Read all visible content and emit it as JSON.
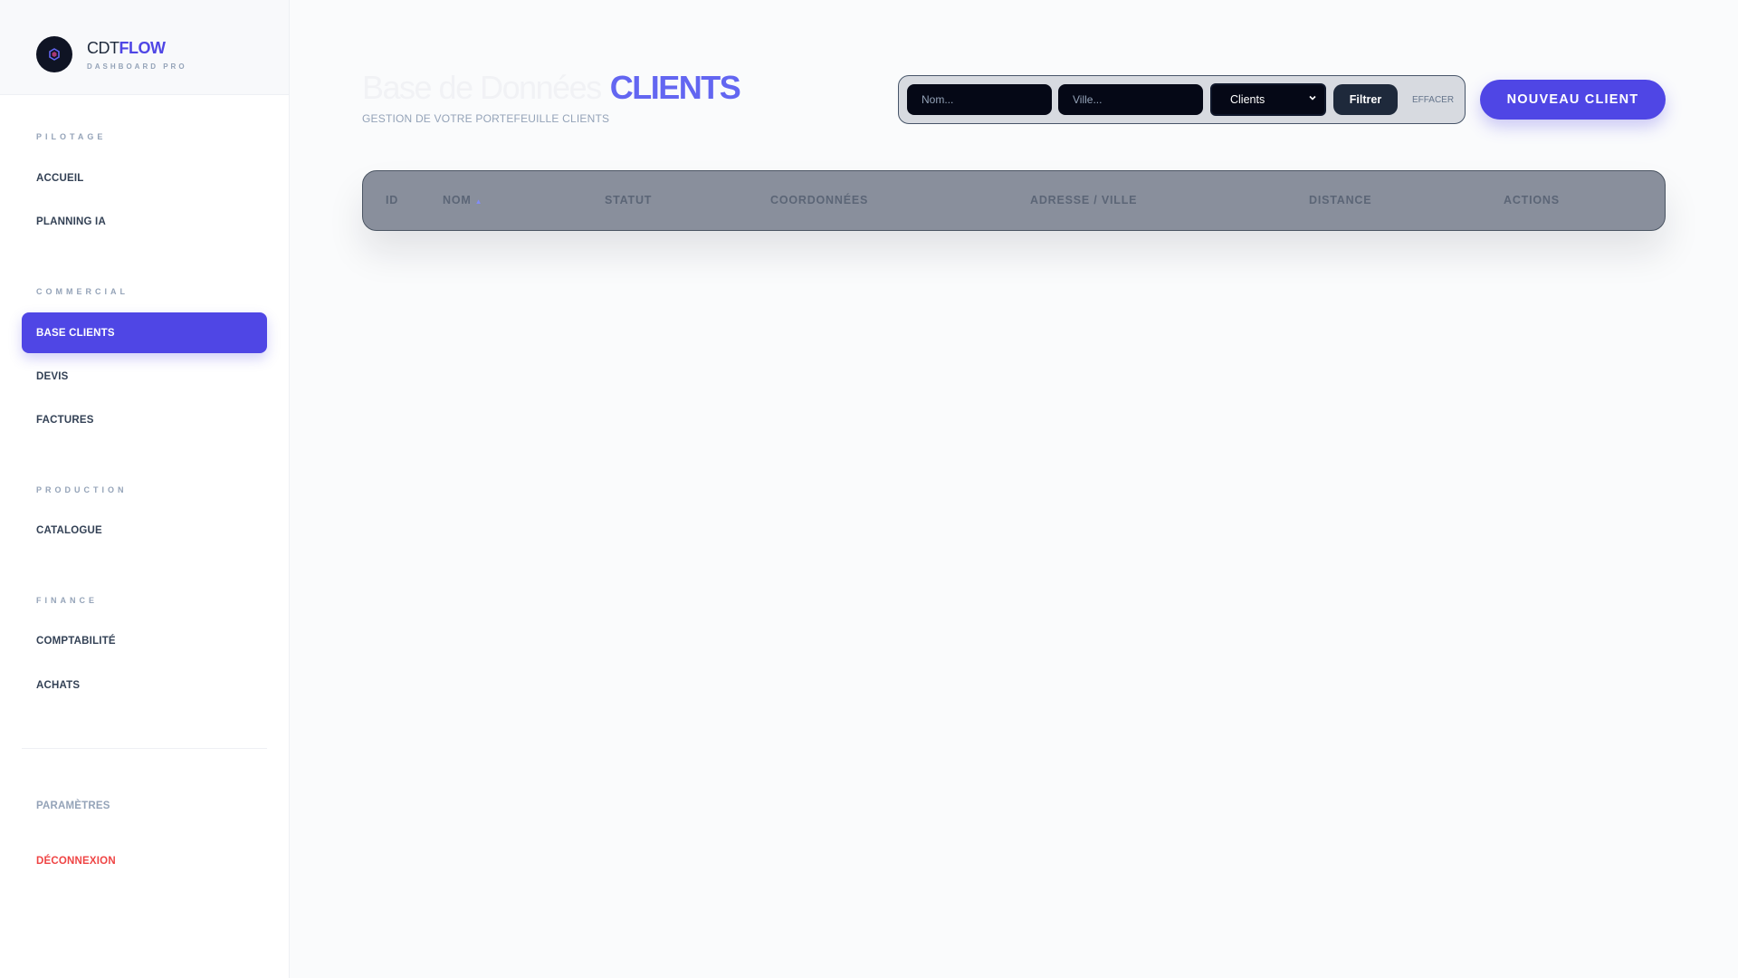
{
  "brand": {
    "name_plain": "CDT",
    "name_accent": "FLOW",
    "subtitle": "DASHBOARD PRO"
  },
  "sidebar": {
    "sections": [
      {
        "label": "PILOTAGE",
        "items": [
          {
            "label": "ACCUEIL"
          },
          {
            "label": "PLANNING IA"
          }
        ]
      },
      {
        "label": "COMMERCIAL",
        "items": [
          {
            "label": "BASE CLIENTS",
            "active": true
          },
          {
            "label": "DEVIS"
          },
          {
            "label": "FACTURES"
          }
        ]
      },
      {
        "label": "PRODUCTION",
        "items": [
          {
            "label": "CATALOGUE"
          }
        ]
      },
      {
        "label": "FINANCE",
        "items": [
          {
            "label": "COMPTABILITÉ"
          },
          {
            "label": "ACHATS"
          }
        ]
      }
    ],
    "footer": {
      "settings": "PARAMÈTRES",
      "logout": "DÉCONNEXION"
    }
  },
  "header": {
    "title_light": "Base de Données",
    "title_strong": "CLIENTS",
    "subtitle": "GESTION DE VOTRE PORTEFEUILLE CLIENTS"
  },
  "filters": {
    "name_placeholder": "Nom...",
    "city_placeholder": "Ville...",
    "type_selected": "Clients",
    "filter_label": "Filtrer",
    "clear_label": "EFFACER"
  },
  "actions": {
    "new_client": "NOUVEAU CLIENT"
  },
  "table": {
    "columns": [
      "ID",
      "NOM",
      "STATUT",
      "COORDONNÉES",
      "ADRESSE / VILLE",
      "DISTANCE",
      "ACTIONS"
    ],
    "sort_indicator": "▲",
    "rows": []
  },
  "colors": {
    "accent": "#4f46e5",
    "accent_light": "#6366f1",
    "danger": "#ef4444",
    "muted": "#94a3b8"
  }
}
